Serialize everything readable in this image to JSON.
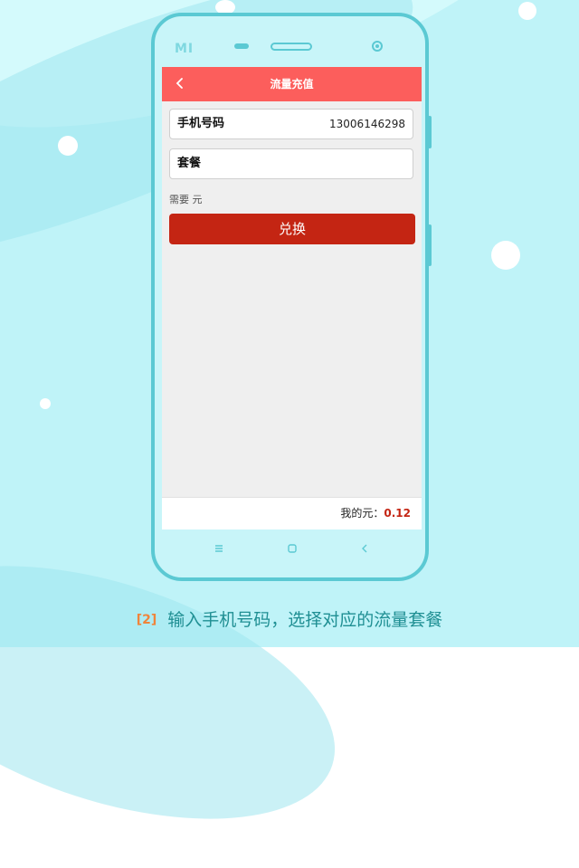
{
  "app": {
    "title": "流量充值",
    "phone_label": "手机号码",
    "phone_value": "13006146298",
    "package_label": "套餐",
    "need_text": "需要  元",
    "exchange_button": "兑换",
    "balance_label": "我的元：",
    "balance_value": "0.12"
  },
  "phone": {
    "brand_logo": "MI"
  },
  "caption": {
    "step": "2",
    "text": "输入手机号码，选择对应的流量套餐"
  },
  "icons": {
    "back": "chevron-left",
    "nav_menu": "menu-icon",
    "nav_home": "home-icon",
    "nav_back": "chevron-left-icon"
  },
  "colors": {
    "background": "#bff3f8",
    "phone_frame": "#5bc9d3",
    "appbar": "#fc5e5c",
    "button": "#c42513",
    "balance_value": "#c42513",
    "caption_text": "#1f8f93",
    "caption_step": "#f0843a"
  }
}
